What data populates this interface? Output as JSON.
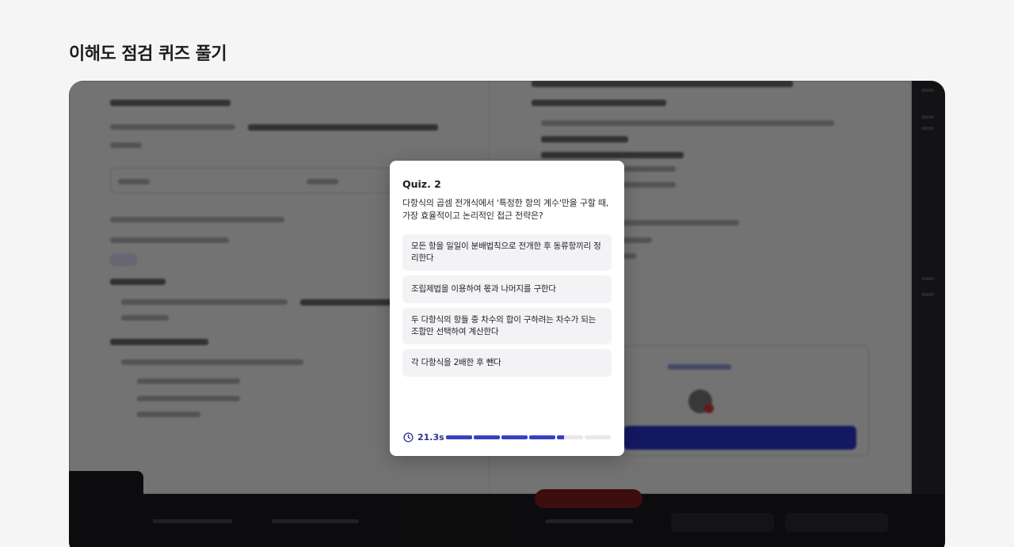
{
  "page": {
    "title": "이해도 점검 퀴즈 풀기"
  },
  "quiz": {
    "title": "Quiz. 2",
    "question": "다항식의 곱셈 전개식에서 '특정한 항의 계수'만을 구할 때, 가장 효율적이고 논리적인 접근 전략은?",
    "options": [
      {
        "label": "모든 항을 일일이 분배법칙으로 전개한 후 동류항끼리 정리한다"
      },
      {
        "label": "조립제법을 이용하여 몫과 나머지를 구한다"
      },
      {
        "label": "두 다항식의 항들 중 차수의 합이 구하려는 차수가 되는 조합만 선택하여 계산한다"
      },
      {
        "label": "각 다항식을 2배한 후 뺀다"
      }
    ],
    "timer": {
      "value": "21.3s",
      "icon": "clock-icon",
      "segments_total": 6,
      "progress_fraction": 0.71
    },
    "colors": {
      "accent": "#3b3fbf",
      "timer_text": "#2d2f8f"
    }
  }
}
